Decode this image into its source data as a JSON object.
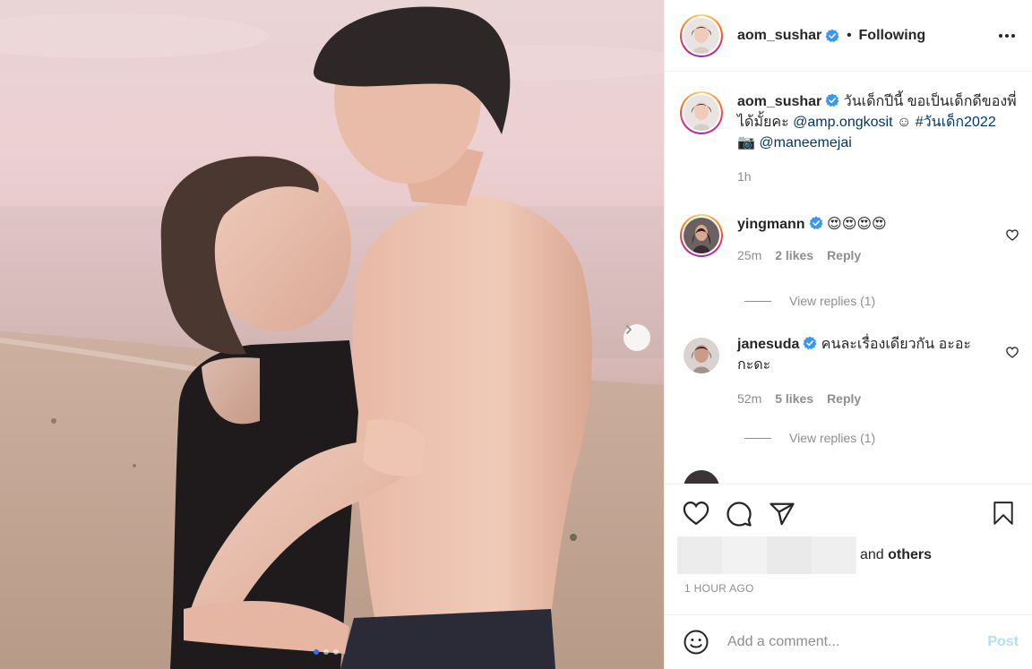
{
  "post": {
    "username": "aom_sushar",
    "follow_status": "Following",
    "separator": "•"
  },
  "caption": {
    "username": "aom_sushar",
    "text_1": " วันเด็กปีนี้ ขอเป็นเด็กดีของพี่ได้มั้ยคะ ",
    "mention_1": "@amp.ongkosit",
    "text_2": " ☺ ",
    "hashtag": "#วันเด็ก2022",
    "text_3": " 📷 ",
    "mention_2": "@maneemejai",
    "time": "1h"
  },
  "comments": [
    {
      "username": "yingmann",
      "text": " 😍😍😍😍",
      "time": "25m",
      "likes": "2 likes",
      "reply": "Reply",
      "view_replies": "View replies (1)"
    },
    {
      "username": "janesuda",
      "text": " คนละเรื่องเดียวกัน อะอะกะดะ",
      "time": "52m",
      "likes": "5 likes",
      "reply": "Reply",
      "view_replies": "View replies (1)"
    }
  ],
  "likes": {
    "and": "and ",
    "others": "others",
    "time_ago": "1 HOUR AGO"
  },
  "add_comment": {
    "placeholder": "Add a comment...",
    "post_label": "Post"
  },
  "carousel": {
    "total_slides": 3,
    "active_slide": 1
  },
  "colors": {
    "verified": "#3897f0",
    "link": "#00376b",
    "post_disabled": "#b2dffc"
  }
}
